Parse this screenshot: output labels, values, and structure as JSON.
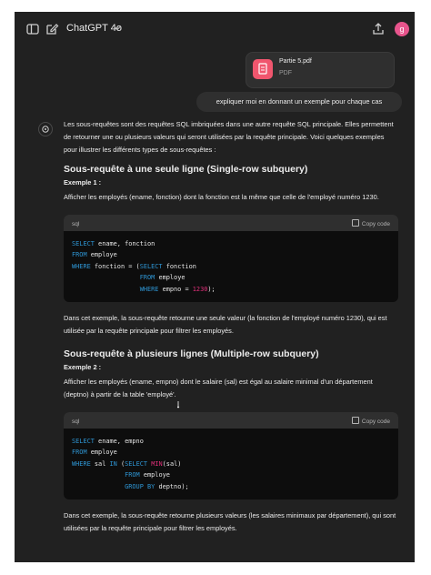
{
  "header": {
    "title": "ChatGPT 4o",
    "avatar_letter": "g"
  },
  "attachment": {
    "name": "Partie 5.pdf",
    "type": "PDF"
  },
  "user_message": "expliquer moi en donnant un exemple pour chaque cas",
  "answer": {
    "intro": "Les sous-requêtes sont des requêtes SQL imbriquées dans une autre requête SQL principale. Elles permettent de retourner une ou plusieurs valeurs qui seront utilisées par la requête principale. Voici quelques exemples pour illustrer les différents types de sous-requêtes :",
    "section1": {
      "heading": "Sous-requête à une seule ligne (Single-row subquery)",
      "example_label": "Exemple 1 :",
      "example_text": "Afficher les employés (ename, fonction) dont la fonction est la même que celle de l'employé numéro 1230.",
      "code_lang": "sql",
      "copy_label": "Copy code",
      "explanation": "Dans cet exemple, la sous-requête retourne une seule valeur (la fonction de l'employé numéro 1230), qui est utilisée par la requête principale pour filtrer les employés."
    },
    "section2": {
      "heading": "Sous-requête à plusieurs lignes (Multiple-row subquery)",
      "example_label": "Exemple 2 :",
      "example_text": "Afficher les employés (ename, empno) dont le salaire (sal) est égal au salaire minimal d'un département (deptno) à partir de la table 'employé'.",
      "code_lang": "sql",
      "copy_label": "Copy code",
      "explanation": "Dans cet exemple, la sous-requête retourne plusieurs valeurs (les salaires minimaux par département), qui sont utilisées par la requête principale pour filtrer les employés."
    }
  },
  "colors": {
    "background": "#212121",
    "keyword": "#2e95d3",
    "function": "#df3079",
    "avatar": "#e8548c",
    "pdf_icon": "#f0566e"
  }
}
